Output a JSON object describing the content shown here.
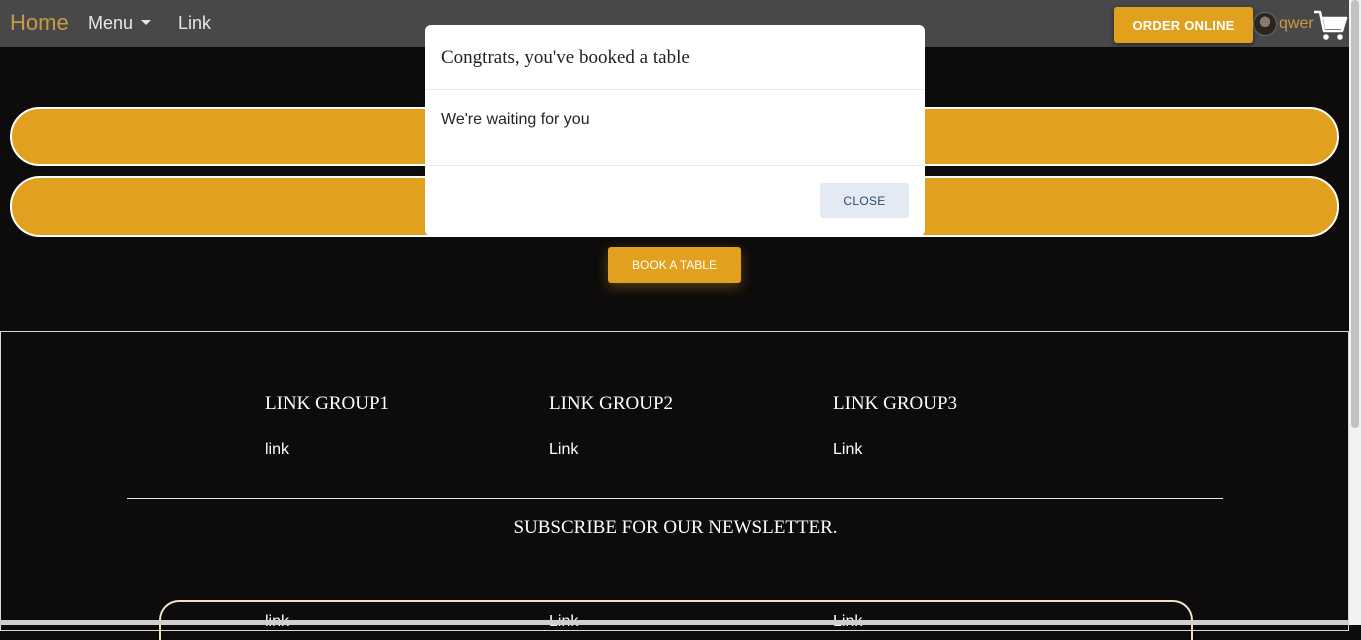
{
  "navbar": {
    "brand": "Home",
    "menu_label": "Menu",
    "link_label": "Link",
    "order_button": "ORDER ONLINE",
    "username": "qwer",
    "brand_color": "#c99a45",
    "background": "#484848"
  },
  "main": {
    "book_button": "BOOK A TABLE",
    "accent_color": "#e2a01f"
  },
  "footer": {
    "groups": [
      {
        "title": "LINK GROUP1",
        "link": "link"
      },
      {
        "title": "LINK GROUP2",
        "link": "Link"
      },
      {
        "title": "LINK GROUP3",
        "link": "Link"
      }
    ],
    "newsletter_heading": "SUBSCRIBE FOR OUR NEWSLETTER."
  },
  "modal": {
    "title": "Congtrats, you've booked a table",
    "body": "We're waiting for you",
    "close_button": "CLOSE"
  }
}
